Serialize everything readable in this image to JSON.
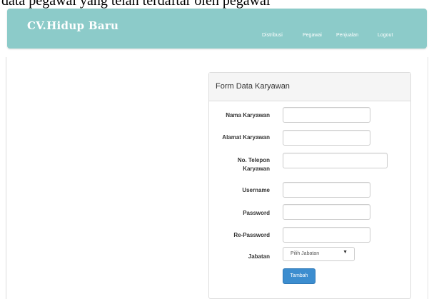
{
  "caption": "data pegawai yang telah terdaftar oleh pegawai",
  "navbar": {
    "brand": "CV.Hidup Baru",
    "links": [
      "Distribusi",
      "Pegawai",
      "Penjualan",
      "Logout"
    ]
  },
  "form": {
    "title": "Form Data Karyawan",
    "fields": [
      {
        "label": "Nama Karyawan",
        "value": ""
      },
      {
        "label": "Alamat Karyawan",
        "value": ""
      },
      {
        "label_line1": "No. Telepon",
        "label_line2": "Karyawan",
        "value": ""
      },
      {
        "label": "Username",
        "value": ""
      },
      {
        "label": "Password",
        "value": ""
      },
      {
        "label": "Re-Password",
        "value": ""
      }
    ],
    "jabatan": {
      "label": "Jabatan",
      "selected": "Pilih Jabatan"
    },
    "submit_label": "Tambah"
  },
  "colors": {
    "navbar_bg": "#8ccbc9",
    "button_bg": "#3c8dcf",
    "panel_heading_bg": "#f5f5f5"
  },
  "icons": {
    "select_caret": "caret-down-icon"
  }
}
